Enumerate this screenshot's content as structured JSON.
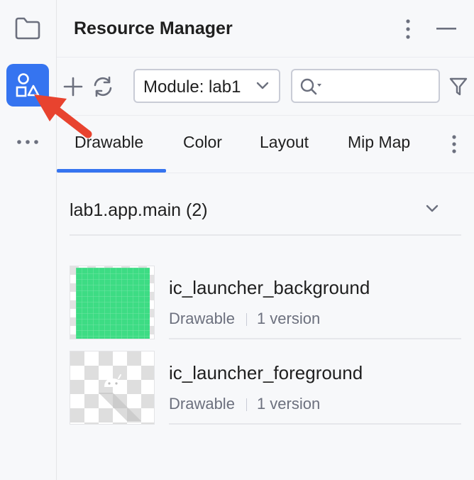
{
  "sidebar": {
    "icons": [
      "folder-icon",
      "resource-manager-icon",
      "more-icon"
    ]
  },
  "panel": {
    "title": "Resource Manager"
  },
  "toolbar": {
    "module_label": "Module: lab1",
    "search_placeholder": ""
  },
  "tabs": [
    {
      "label": "Drawable",
      "selected": true
    },
    {
      "label": "Color",
      "selected": false
    },
    {
      "label": "Layout",
      "selected": false
    },
    {
      "label": "Mip Map",
      "selected": false
    }
  ],
  "group": {
    "title": "lab1.app.main (2)"
  },
  "resources": [
    {
      "name": "ic_launcher_background",
      "type": "Drawable",
      "versions": "1 version"
    },
    {
      "name": "ic_launcher_foreground",
      "type": "Drawable",
      "versions": "1 version"
    }
  ],
  "colors": {
    "accent": "#3574f0",
    "arrow": "#e8432f",
    "launcher_green": "#3ddc84"
  }
}
